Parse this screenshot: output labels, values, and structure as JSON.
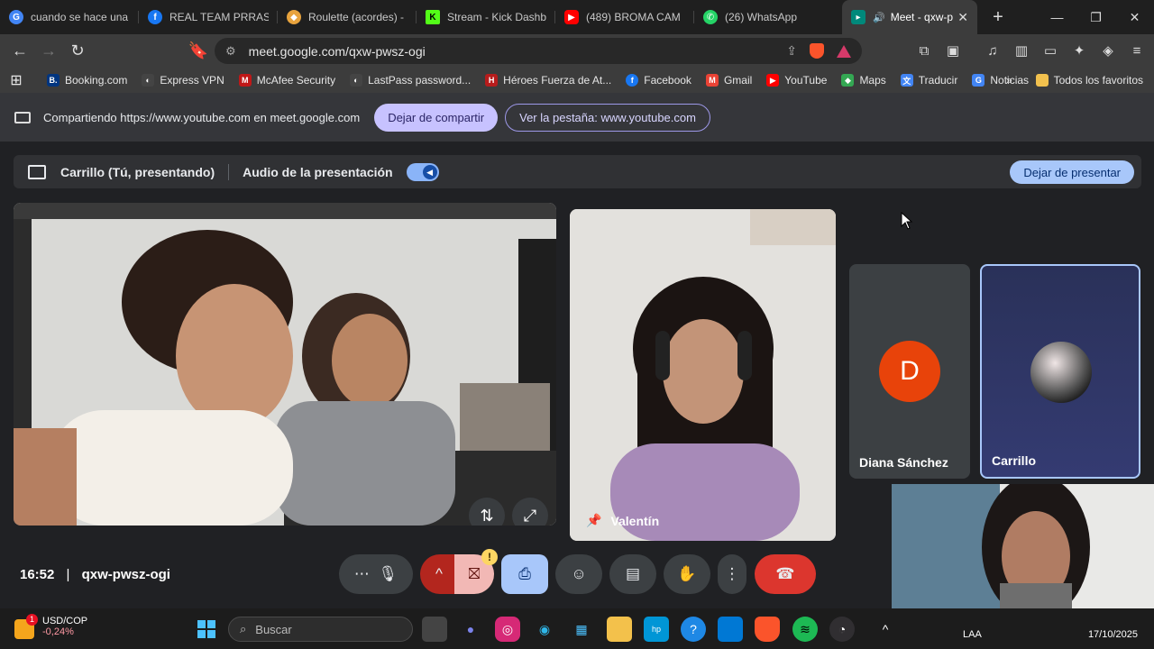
{
  "browser": {
    "tabs": [
      {
        "title": "cuando se hace una n",
        "icon": "google-icon",
        "color": "#4285f4"
      },
      {
        "title": "REAL TEAM PRRAS! | F",
        "icon": "facebook-icon",
        "color": "#1877f2"
      },
      {
        "title": "Roulette (acordes) - S",
        "icon": "shield-icon",
        "color": "#e8a33d"
      },
      {
        "title": "Stream - Kick Dashbo",
        "icon": "kick-icon",
        "color": "#53fc18"
      },
      {
        "title": "(489) BROMA CAM",
        "icon": "youtube-icon",
        "color": "#ff0000"
      },
      {
        "title": "(26) WhatsApp",
        "icon": "whatsapp-icon",
        "color": "#25d366"
      },
      {
        "title": "Meet - qxw-p",
        "icon": "meet-icon",
        "color": "#00897b",
        "active": true
      }
    ],
    "new_tab": "+",
    "url": "meet.google.com/qxw-pwsz-ogi",
    "bookmarks": [
      {
        "label": "Booking.com",
        "color": "#003580",
        "glyph": "B."
      },
      {
        "label": "Express VPN",
        "color": "#444",
        "glyph": "◐"
      },
      {
        "label": "McAfee Security",
        "color": "#c01818",
        "glyph": "M"
      },
      {
        "label": "LastPass password...",
        "color": "#444",
        "glyph": "◐"
      },
      {
        "label": "Héroes Fuerza de At...",
        "color": "#b71c1c",
        "glyph": "H"
      },
      {
        "label": "Facebook",
        "color": "#1877f2",
        "glyph": "f"
      },
      {
        "label": "Gmail",
        "color": "#ea4335",
        "glyph": "M"
      },
      {
        "label": "YouTube",
        "color": "#ff0000",
        "glyph": "▶"
      },
      {
        "label": "Maps",
        "color": "#34a853",
        "glyph": "◆"
      },
      {
        "label": "Traducir",
        "color": "#4285f4",
        "glyph": "文"
      },
      {
        "label": "Noticias",
        "color": "#4285f4",
        "glyph": "G"
      }
    ],
    "bookmarks_more": "»",
    "all_bookmarks": "Todos los favoritos"
  },
  "sharebar": {
    "text": "Compartiendo https://www.youtube.com en meet.google.com",
    "stop_label": "Dejar de compartir",
    "view_label": "Ver la pestaña: www.youtube.com"
  },
  "presbar": {
    "presenter": "Carrillo (Tú, presentando)",
    "audio_label": "Audio de la presentación",
    "stop_label": "Dejar de presentar"
  },
  "participants": {
    "valentin": "Valentín",
    "diana": "Diana Sánchez",
    "diana_initial": "D",
    "carrillo": "Carrillo"
  },
  "meet": {
    "time": "16:52",
    "code": "qxw-pwsz-ogi",
    "warn_badge": "!"
  },
  "taskbar": {
    "weather_pair": "USD/COP",
    "weather_change": "-0,24%",
    "weather_badge": "1",
    "search_placeholder": "Buscar",
    "lang": "LAA",
    "date": "17/10/2025"
  }
}
